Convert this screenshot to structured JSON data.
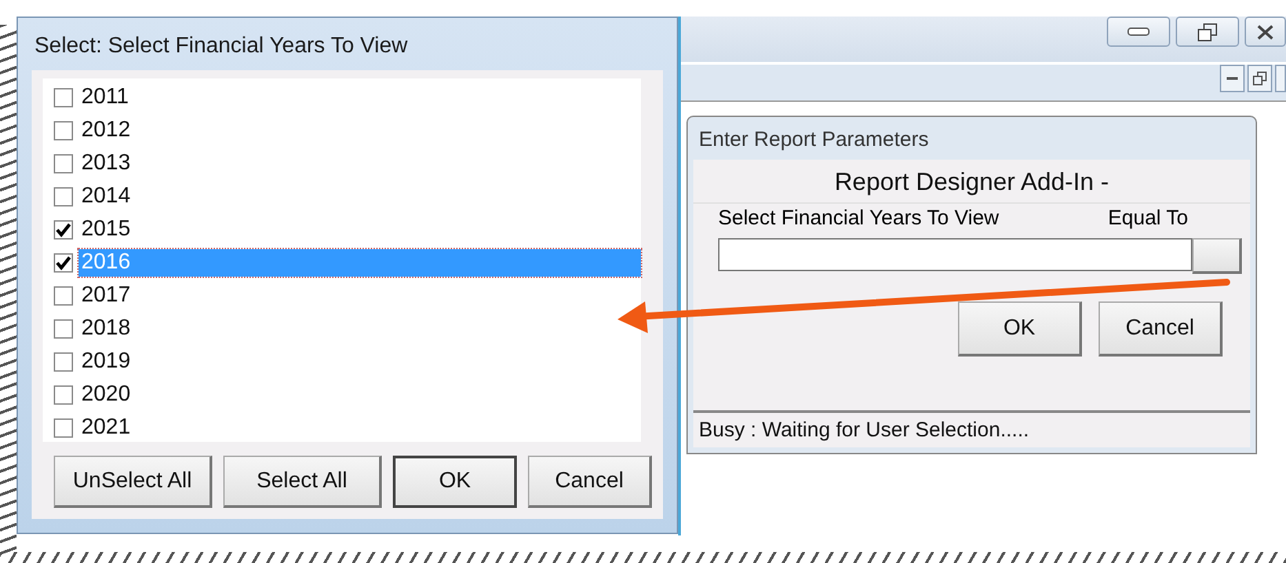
{
  "select_dialog": {
    "title": "Select: Select Financial Years To View",
    "years": [
      {
        "label": "2011",
        "checked": false,
        "selected": false
      },
      {
        "label": "2012",
        "checked": false,
        "selected": false
      },
      {
        "label": "2013",
        "checked": false,
        "selected": false
      },
      {
        "label": "2014",
        "checked": false,
        "selected": false
      },
      {
        "label": "2015",
        "checked": true,
        "selected": false
      },
      {
        "label": "2016",
        "checked": true,
        "selected": true
      },
      {
        "label": "2017",
        "checked": false,
        "selected": false
      },
      {
        "label": "2018",
        "checked": false,
        "selected": false
      },
      {
        "label": "2019",
        "checked": false,
        "selected": false
      },
      {
        "label": "2020",
        "checked": false,
        "selected": false
      },
      {
        "label": "2021",
        "checked": false,
        "selected": false
      }
    ],
    "buttons": [
      {
        "label": "UnSelect All",
        "default": false
      },
      {
        "label": "Select All",
        "default": false
      },
      {
        "label": "OK",
        "default": true
      },
      {
        "label": "Cancel",
        "default": false
      }
    ]
  },
  "report_dialog": {
    "title": "Enter Report Parameters",
    "heading": "Report Designer Add-In -",
    "parameter_label": "Select Financial Years To View",
    "operator": "Equal To",
    "buttons": [
      {
        "label": "OK",
        "default": false
      },
      {
        "label": "Cancel",
        "default": false
      }
    ],
    "status": "Busy : Waiting for User Selection....."
  }
}
